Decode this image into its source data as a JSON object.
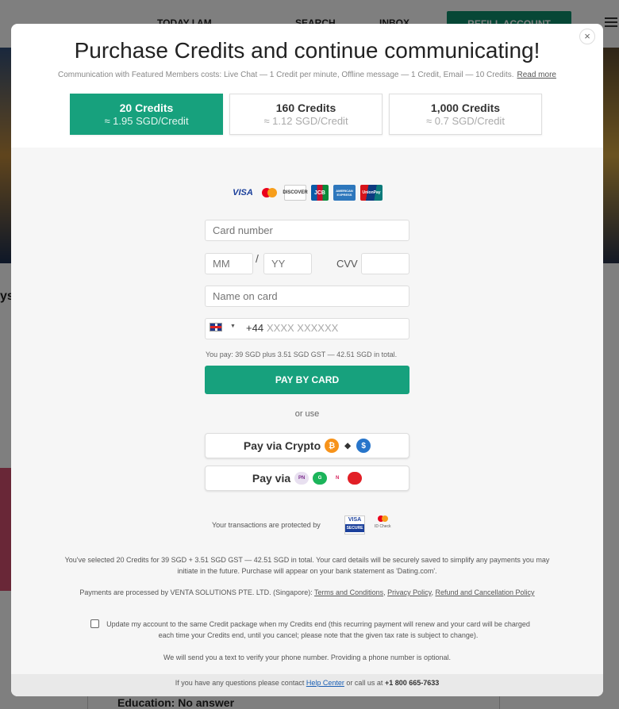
{
  "background": {
    "nav_today": "TODAY I AM",
    "nav_search": "SEARCH",
    "nav_inbox": "INBOX",
    "refill_label": "REFILL ACCOUNT",
    "side_text": "ys",
    "card_text": "Education: No answer"
  },
  "modal": {
    "title": "Purchase Credits and continue communicating!",
    "subtitle": "Communication with Featured Members costs: Live Chat — 1 Credit per minute, Offline message — 1 Credit, Email — 10 Credits.",
    "read_more": "Read more",
    "close": "×"
  },
  "packages": [
    {
      "title": "20 Credits",
      "price": "≈ 1.95 SGD/Credit",
      "selected": true
    },
    {
      "title": "160 Credits",
      "price": "≈ 1.12 SGD/Credit",
      "selected": false
    },
    {
      "title": "1,000 Credits",
      "price": "≈ 0.7 SGD/Credit",
      "selected": false
    }
  ],
  "card_logos": [
    "VISA",
    "Mastercard",
    "DISCOVER",
    "JCB",
    "AMERICAN EXPRESS",
    "UnionPay"
  ],
  "form": {
    "card_number_placeholder": "Card number",
    "mm_placeholder": "MM",
    "slash": "/",
    "yy_placeholder": "YY",
    "cvv_label": "CVV",
    "name_placeholder": "Name on card",
    "phone_code": "+44",
    "phone_placeholder": "XXXX XXXXXX",
    "you_pay": "You pay: 39 SGD plus 3.51 SGD GST — 42.51 SGD in total.",
    "pay_button": "PAY BY CARD",
    "or_use": "or use",
    "crypto_button": "Pay via Crypto",
    "paynow_button": "Pay via"
  },
  "security": {
    "protected_text": "Your transactions are protected by",
    "visa_secure": "VISA",
    "visa_secure_sub": "SECURE",
    "id_check": "ID Check"
  },
  "info": {
    "selected_text": "You've selected 20 Credits for 39 SGD + 3.51 SGD GST — 42.51 SGD in total. Your card details will be securely saved to simplify any payments you may initiate in the future. Purchase will appear on your bank statement as 'Dating.com'.",
    "processed_prefix": "Payments are processed by VENTA SOLUTIONS PTE. LTD. (Singapore):",
    "terms_link": "Terms and Conditions",
    "privacy_link": "Privacy Policy",
    "refund_link": "Refund and Cancellation Policy",
    "update_text": "Update my account to the same Credit package when my Credits end (this recurring payment will renew and your card will be charged each time your Credits end, until you cancel; please note that the given tax rate is subject to change).",
    "phone_note": "We will send you a text to verify your phone number. Providing a phone number is optional."
  },
  "footer": {
    "prefix": "If you have any questions please contact",
    "help_link": "Help Center",
    "middle": "or call us at",
    "phone": "+1 800 665-7633"
  }
}
